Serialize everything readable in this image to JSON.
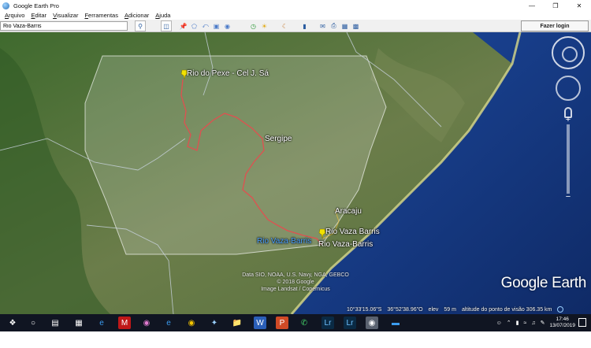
{
  "window": {
    "title": "Google Earth Pro",
    "controls": {
      "minimize": "—",
      "maximize": "❐",
      "close": "✕"
    }
  },
  "menu": {
    "items": [
      "Arquivo",
      "Editar",
      "Visualizar",
      "Ferramentas",
      "Adicionar",
      "Ajuda"
    ]
  },
  "toolbar": {
    "search_value": "Rio Vaza-Barris",
    "login_label": "Fazer login",
    "icons": [
      "placemark-icon",
      "polygon-icon",
      "path-icon",
      "overlay-icon",
      "tour-icon",
      "history-icon",
      "sun-icon",
      "planets-icon",
      "ruler-icon",
      "email-icon",
      "print-icon",
      "save-image-icon",
      "maps-icon"
    ]
  },
  "map": {
    "labels": {
      "rio_do_pexe": "Rio do Pexe - Cel J. Sá",
      "sergipe": "Sergipe",
      "aracaju": "Aracaju",
      "vaza_barris_1": "Rio Vaza Barris",
      "vaza_barris_2": "Rio Vaza-Barris",
      "vaza_barris_blue": "Rio Vaza-Barris"
    },
    "credits": {
      "line1": "Data SIO, NOAA, U.S. Navy, NGA, GEBCO",
      "line2": "© 2018 Google",
      "line3": "Image Landsat / Copernicus"
    },
    "logo": "Google Earth",
    "status": {
      "lat": "10°33'15.06\"S",
      "lon": "36°52'38.96\"O",
      "elev_label": "elev",
      "elev_value": "59 m",
      "altitude": "altitude do ponto de visão 306.35 km"
    },
    "colors": {
      "land": "#5d7a45",
      "ocean": "#1c3d8a",
      "state_border": "#e05050",
      "pin": "#f2e300"
    }
  },
  "taskbar": {
    "clock_time": "17:46",
    "clock_date": "13/07/2019",
    "apps": [
      "start-icon",
      "search-icon",
      "task-view-icon",
      "calculator-icon",
      "edge-icon",
      "mcafee-icon",
      "media-icon",
      "ie-icon",
      "chrome-icon",
      "app-icon",
      "explorer-icon",
      "word-icon",
      "powerpoint-icon",
      "whatsapp-icon",
      "lightroom-icon",
      "lightroom-classic-icon",
      "google-earth-icon",
      "app2-icon"
    ]
  }
}
